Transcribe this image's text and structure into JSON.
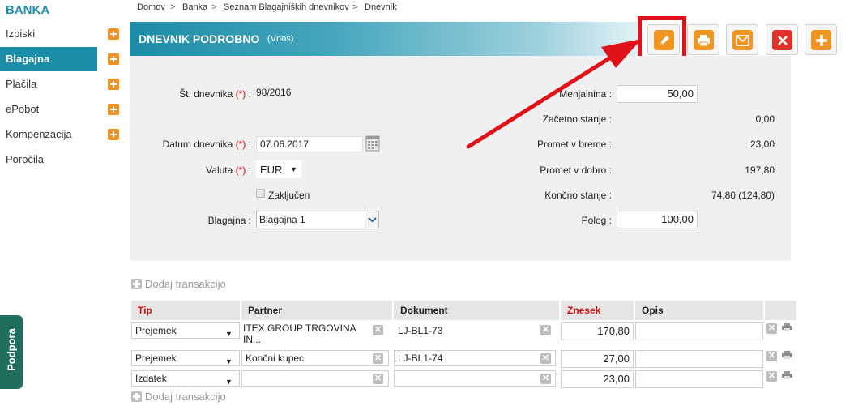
{
  "brand": "BANKA",
  "sidebar": {
    "items": [
      {
        "label": "Izpiski",
        "has_plus": true
      },
      {
        "label": "Blagajna",
        "has_plus": true,
        "active": true
      },
      {
        "label": "Plačila",
        "has_plus": true
      },
      {
        "label": "ePobot",
        "has_plus": true
      },
      {
        "label": "Kompenzacija",
        "has_plus": true
      },
      {
        "label": "Poročila",
        "has_plus": false
      }
    ],
    "support_tab": "Podpora"
  },
  "breadcrumb": [
    "Domov",
    "Banka",
    "Seznam Blagajniških dnevnikov",
    "Dnevnik"
  ],
  "header": {
    "title": "DNEVNIK PODROBNO",
    "subtitle": "(Vnos)"
  },
  "toolbar": {
    "buttons": [
      {
        "icon": "pencil-icon",
        "color": "#f0951f"
      },
      {
        "icon": "printer-icon",
        "color": "#f0951f"
      },
      {
        "icon": "envelope-icon",
        "color": "#f0951f"
      },
      {
        "icon": "close-icon",
        "color": "#e2302a"
      },
      {
        "icon": "plus-icon",
        "color": "#f0951f"
      }
    ],
    "highlight_color": "#e0131a"
  },
  "form": {
    "journal_no_label": "Št. dnevnika",
    "journal_no_value": "98/2016",
    "date_label": "Datum dnevnika",
    "date_value": "07.06.2017",
    "currency_label": "Valuta",
    "currency_value": "EUR",
    "closed_label": "Zaključen",
    "cashbox_label": "Blagajna :",
    "cashbox_value": "Blagajna 1",
    "required_mark": "(*)",
    "colon": ":"
  },
  "summary": {
    "exchange_label": "Menjalnina :",
    "exchange_value": "50,00",
    "opening_label": "Začetno stanje :",
    "opening_value": "0,00",
    "debit_label": "Promet v breme :",
    "debit_value": "23,00",
    "credit_label": "Promet v dobro :",
    "credit_value": "197,80",
    "closing_label": "Končno stanje :",
    "closing_value": "74,80 (124,80)",
    "deposit_label": "Polog :",
    "deposit_value": "100,00"
  },
  "transactions": {
    "add_label": "Dodaj transakcijo",
    "columns": [
      "Tip",
      "Partner",
      "Dokument",
      "Znesek",
      "Opis"
    ],
    "rows": [
      {
        "type": "Prejemek",
        "partner": "ITEX GROUP TRGOVINA IN...",
        "document": "LJ-BL1-73",
        "amount": "170,80",
        "description": ""
      },
      {
        "type": "Prejemek",
        "partner": "Končni kupec",
        "document": "LJ-BL1-74",
        "amount": "27,00",
        "description": ""
      },
      {
        "type": "Izdatek",
        "partner": "",
        "document": "",
        "amount": "23,00",
        "description": ""
      }
    ]
  },
  "colors": {
    "accent": "#1a8fa7",
    "required": "#d01010",
    "orange": "#f3901f",
    "support": "#1f6e5e"
  }
}
